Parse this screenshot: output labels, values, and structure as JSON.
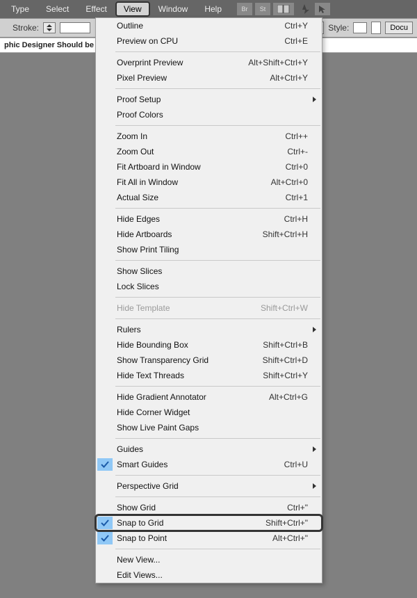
{
  "menubar": {
    "items": [
      "Type",
      "Select",
      "Effect",
      "View",
      "Window",
      "Help"
    ],
    "active_index": 3
  },
  "mb_icons": [
    "Br",
    "St"
  ],
  "toolbar": {
    "stroke_label": "Stroke:",
    "style_label": "Style:",
    "doc_button": "Docu"
  },
  "tab": {
    "title": "phic Designer Should be Us"
  },
  "menu": [
    {
      "type": "item",
      "label": "Outline",
      "shortcut": "Ctrl+Y"
    },
    {
      "type": "item",
      "label": "Preview on CPU",
      "shortcut": "Ctrl+E"
    },
    {
      "type": "sep"
    },
    {
      "type": "item",
      "label": "Overprint Preview",
      "shortcut": "Alt+Shift+Ctrl+Y"
    },
    {
      "type": "item",
      "label": "Pixel Preview",
      "shortcut": "Alt+Ctrl+Y"
    },
    {
      "type": "sep"
    },
    {
      "type": "item",
      "label": "Proof Setup",
      "submenu": true
    },
    {
      "type": "item",
      "label": "Proof Colors"
    },
    {
      "type": "sep"
    },
    {
      "type": "item",
      "label": "Zoom In",
      "shortcut": "Ctrl++"
    },
    {
      "type": "item",
      "label": "Zoom Out",
      "shortcut": "Ctrl+-"
    },
    {
      "type": "item",
      "label": "Fit Artboard in Window",
      "shortcut": "Ctrl+0"
    },
    {
      "type": "item",
      "label": "Fit All in Window",
      "shortcut": "Alt+Ctrl+0"
    },
    {
      "type": "item",
      "label": "Actual Size",
      "shortcut": "Ctrl+1"
    },
    {
      "type": "sep"
    },
    {
      "type": "item",
      "label": "Hide Edges",
      "shortcut": "Ctrl+H"
    },
    {
      "type": "item",
      "label": "Hide Artboards",
      "shortcut": "Shift+Ctrl+H"
    },
    {
      "type": "item",
      "label": "Show Print Tiling"
    },
    {
      "type": "sep"
    },
    {
      "type": "item",
      "label": "Show Slices"
    },
    {
      "type": "item",
      "label": "Lock Slices"
    },
    {
      "type": "sep"
    },
    {
      "type": "item",
      "label": "Hide Template",
      "shortcut": "Shift+Ctrl+W",
      "disabled": true
    },
    {
      "type": "sep"
    },
    {
      "type": "item",
      "label": "Rulers",
      "submenu": true
    },
    {
      "type": "item",
      "label": "Hide Bounding Box",
      "shortcut": "Shift+Ctrl+B"
    },
    {
      "type": "item",
      "label": "Show Transparency Grid",
      "shortcut": "Shift+Ctrl+D"
    },
    {
      "type": "item",
      "label": "Hide Text Threads",
      "shortcut": "Shift+Ctrl+Y"
    },
    {
      "type": "sep"
    },
    {
      "type": "item",
      "label": "Hide Gradient Annotator",
      "shortcut": "Alt+Ctrl+G"
    },
    {
      "type": "item",
      "label": "Hide Corner Widget"
    },
    {
      "type": "item",
      "label": "Show Live Paint Gaps"
    },
    {
      "type": "sep"
    },
    {
      "type": "item",
      "label": "Guides",
      "submenu": true
    },
    {
      "type": "item",
      "label": "Smart Guides",
      "shortcut": "Ctrl+U",
      "checked": true
    },
    {
      "type": "sep"
    },
    {
      "type": "item",
      "label": "Perspective Grid",
      "submenu": true
    },
    {
      "type": "sep"
    },
    {
      "type": "item",
      "label": "Show Grid",
      "shortcut": "Ctrl+\""
    },
    {
      "type": "item",
      "label": "Snap to Grid",
      "shortcut": "Shift+Ctrl+\"",
      "checked": true,
      "highlight": true
    },
    {
      "type": "item",
      "label": "Snap to Point",
      "shortcut": "Alt+Ctrl+\"",
      "checked": true
    },
    {
      "type": "sep"
    },
    {
      "type": "item",
      "label": "New View..."
    },
    {
      "type": "item",
      "label": "Edit Views..."
    }
  ]
}
